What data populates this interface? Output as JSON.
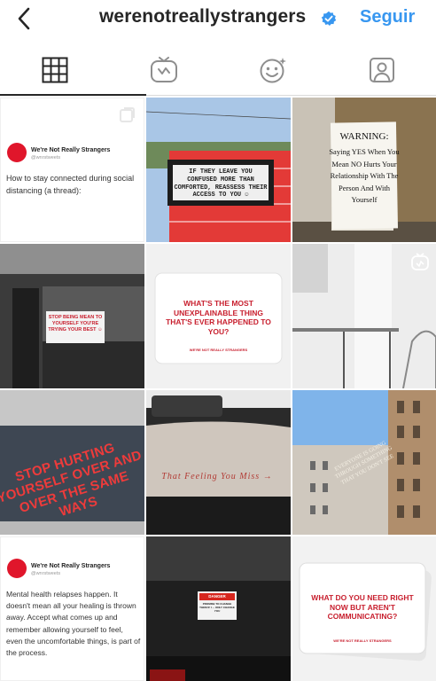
{
  "header": {
    "username": "werenotreallystrangers",
    "follow_label": "Seguir",
    "verified_color": "#3897f0"
  },
  "tabs": [
    {
      "icon": "grid-icon",
      "active": true
    },
    {
      "icon": "igtv-icon",
      "active": false
    },
    {
      "icon": "effects-icon",
      "active": false
    },
    {
      "icon": "tagged-icon",
      "active": false
    }
  ],
  "posts": {
    "p1": {
      "account_name": "We're Not Really Strangers",
      "handle": "@wnrstweets",
      "text": "How to stay connected during social distancing (a thread):"
    },
    "p2": {
      "sign_text": "IF THEY LEAVE YOU CONFUSED MORE THAN COMFORTED, REASSESS THEIR ACCESS TO YOU ☺"
    },
    "p3": {
      "title": "WARNING:",
      "text": "Saying YES When You Mean NO Hurts Your Relationship With The Person And With Yourself"
    },
    "p4": {
      "sign_text": "STOP BEING MEAN TO YOURSELF YOU'RE TRYING YOUR BEST ☺"
    },
    "p5": {
      "question": "WHAT'S THE MOST UNEXPLAINABLE THING THAT'S EVER HAPPENED TO YOU?",
      "brand": "WE'RE NOT REALLY STRANGERS"
    },
    "p6": {},
    "p7": {
      "text": "STOP HURTING YOURSELF OVER AND OVER THE SAME WAYS"
    },
    "p8": {
      "text": "That Feeling You Miss →"
    },
    "p9": {
      "text": "EVERYONE IS GOING THROUGH SOMETHING THAT YOU DON'T SEE"
    },
    "p10": {
      "account_name": "We're Not Really Strangers",
      "handle": "@wnrstweets",
      "text": "Mental health relapses happen. It doesn't mean all your healing is thrown away. Accept what comes up and remember allowing yourself to feel, even the uncomfortable things, is part of the process."
    },
    "p11": {
      "sticker_title": "DANGER",
      "sticker_text": "PROMISE TO CHANGE THEM IF I ... ONLY CHANGE YOU"
    },
    "p12": {
      "question": "WHAT DO YOU NEED RIGHT NOW BUT AREN'T COMMUNICATING?",
      "brand": "WE'RE NOT REALLY STRANGERS"
    }
  }
}
